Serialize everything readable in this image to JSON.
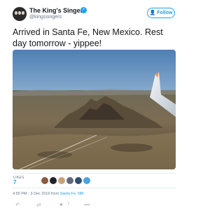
{
  "account": {
    "display_name": "The King's Singers",
    "handle": "@kingssingers",
    "verified_icon": "verified-badge-icon",
    "follow_label": "Follow"
  },
  "tweet": {
    "text": "Arrived in Santa Fe, New Mexico. Rest day tomorrow - yippee!"
  },
  "stats": {
    "likes_label": "LIKES",
    "likes_count": "7"
  },
  "meta": {
    "time": "4:55 PM - 3 Dec 2016 from",
    "location": "Santa Fe, NM"
  },
  "actions": {
    "like_count": "7"
  },
  "colors": {
    "accent": "#1da1f2",
    "text": "#14171a",
    "muted": "#657786",
    "action_icon": "#aab8c2"
  }
}
